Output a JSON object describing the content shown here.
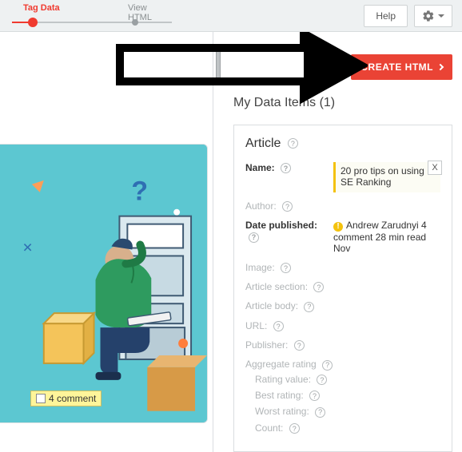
{
  "toolbar": {
    "step1": "Tag Data",
    "step2": "View HTML",
    "help_label": "Help"
  },
  "actions": {
    "create_html": "CREATE HTML"
  },
  "section": {
    "title": "My Data Items (1)"
  },
  "card": {
    "header": "Article",
    "labels": {
      "name": "Name:",
      "author": "Author:",
      "date_published": "Date published:",
      "image": "Image:",
      "article_section": "Article section:",
      "article_body": "Article body:",
      "url": "URL:",
      "publisher": "Publisher:",
      "aggregate_rating": "Aggregate rating",
      "rating_value": "Rating value:",
      "best_rating": "Best rating:",
      "worst_rating": "Worst rating:",
      "count": "Count:"
    },
    "values": {
      "name": "20 pro tips on using SE Ranking",
      "date_published": "Andrew Zarudnyi 4 comment 28 min read Nov"
    }
  },
  "preview": {
    "tag_text": "4 comment"
  }
}
